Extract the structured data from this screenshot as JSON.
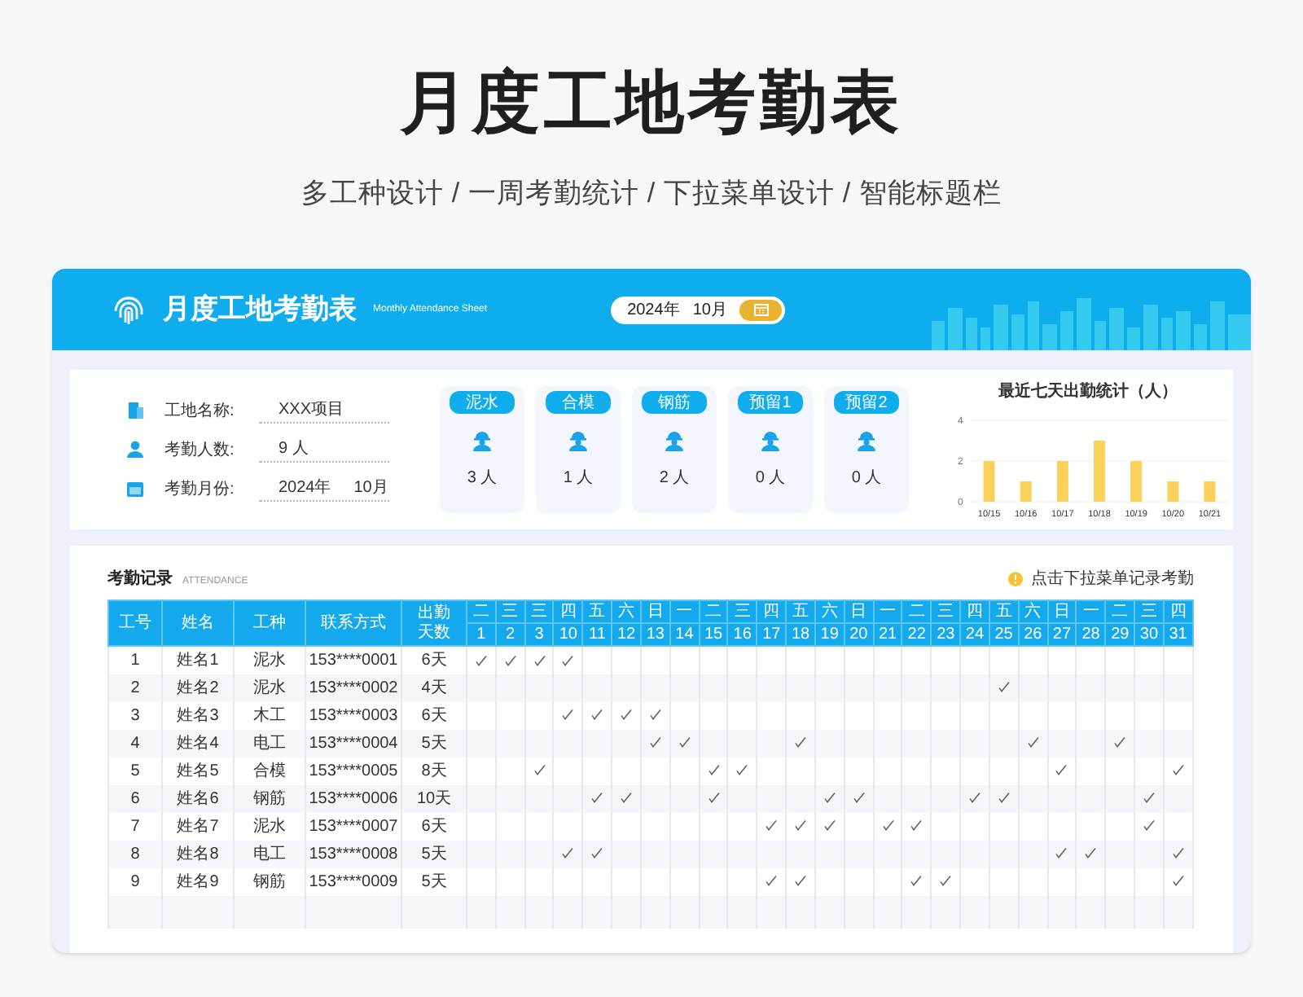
{
  "page_title": "月度工地考勤表",
  "page_subtitle": "多工种设计 / 一周考勤统计 / 下拉菜单设计 / 智能标题栏",
  "header": {
    "title": "月度工地考勤表",
    "subtitle": "Monthly Attendance Sheet",
    "year": "2024年",
    "month": "10月"
  },
  "site_info": [
    {
      "kind": "site",
      "label": "工地名称:",
      "values": [
        "XXX项目"
      ]
    },
    {
      "kind": "headcount",
      "label": "考勤人数:",
      "values": [
        "9 人"
      ]
    },
    {
      "kind": "month",
      "label": "考勤月份:",
      "values": [
        "2024年",
        "10月"
      ]
    }
  ],
  "trades": [
    {
      "name": "泥水",
      "count": "3 人"
    },
    {
      "name": "合模",
      "count": "1 人"
    },
    {
      "name": "钢筋",
      "count": "2 人"
    },
    {
      "name": "预留1",
      "count": "0 人"
    },
    {
      "name": "预留2",
      "count": "0 人"
    }
  ],
  "chart": {
    "title": "最近七天出勤统计（人）",
    "chart_data": {
      "type": "bar",
      "categories": [
        "10/15",
        "10/16",
        "10/17",
        "10/18",
        "10/19",
        "10/20",
        "10/21"
      ],
      "series": [
        {
          "color": "#fbd15b",
          "values": [
            2,
            1,
            2,
            3,
            2,
            1,
            1
          ]
        }
      ],
      "ylim": [
        0,
        4
      ],
      "yticks": [
        {
          "value": 0,
          "label": "0"
        },
        {
          "value": 2,
          "label": "2"
        },
        {
          "value": 4,
          "label": "4"
        }
      ]
    }
  },
  "attendance": {
    "title": "考勤记录",
    "subtitle": "ATTENDANCE",
    "hint": "点击下拉菜单记录考勤",
    "columns": [
      "工号",
      "姓名",
      "工种",
      "联系方式",
      "出勤天数"
    ],
    "days": [
      {
        "weekday": "二",
        "day": "1"
      },
      {
        "weekday": "三",
        "day": "2"
      },
      {
        "weekday": "三",
        "day": "3"
      },
      {
        "weekday": "四",
        "day": "10"
      },
      {
        "weekday": "五",
        "day": "11"
      },
      {
        "weekday": "六",
        "day": "12"
      },
      {
        "weekday": "日",
        "day": "13"
      },
      {
        "weekday": "一",
        "day": "14"
      },
      {
        "weekday": "二",
        "day": "15"
      },
      {
        "weekday": "三",
        "day": "16"
      },
      {
        "weekday": "四",
        "day": "17"
      },
      {
        "weekday": "五",
        "day": "18"
      },
      {
        "weekday": "六",
        "day": "19"
      },
      {
        "weekday": "日",
        "day": "20"
      },
      {
        "weekday": "一",
        "day": "21"
      },
      {
        "weekday": "二",
        "day": "22"
      },
      {
        "weekday": "三",
        "day": "23"
      },
      {
        "weekday": "四",
        "day": "24"
      },
      {
        "weekday": "五",
        "day": "25"
      },
      {
        "weekday": "六",
        "day": "26"
      },
      {
        "weekday": "日",
        "day": "27"
      },
      {
        "weekday": "一",
        "day": "28"
      },
      {
        "weekday": "二",
        "day": "29"
      },
      {
        "weekday": "三",
        "day": "30"
      },
      {
        "weekday": "四",
        "day": "31"
      }
    ],
    "rows": [
      {
        "id": "1",
        "name": "姓名1",
        "trade": "泥水",
        "phone": "153****0001",
        "days_present": "6天",
        "present": [
          true,
          true,
          true,
          true,
          false,
          false,
          false,
          false,
          false,
          false,
          false,
          false,
          false,
          false,
          false,
          false,
          false,
          false,
          false,
          false,
          false,
          false,
          false,
          false,
          false
        ]
      },
      {
        "id": "2",
        "name": "姓名2",
        "trade": "泥水",
        "phone": "153****0002",
        "days_present": "4天",
        "present": [
          false,
          false,
          false,
          false,
          false,
          false,
          false,
          false,
          false,
          false,
          false,
          false,
          false,
          false,
          false,
          false,
          false,
          false,
          true,
          false,
          false,
          false,
          false,
          false,
          false
        ]
      },
      {
        "id": "3",
        "name": "姓名3",
        "trade": "木工",
        "phone": "153****0003",
        "days_present": "6天",
        "present": [
          false,
          false,
          false,
          true,
          true,
          true,
          true,
          false,
          false,
          false,
          false,
          false,
          false,
          false,
          false,
          false,
          false,
          false,
          false,
          false,
          false,
          false,
          false,
          false,
          false
        ]
      },
      {
        "id": "4",
        "name": "姓名4",
        "trade": "电工",
        "phone": "153****0004",
        "days_present": "5天",
        "present": [
          false,
          false,
          false,
          false,
          false,
          false,
          true,
          true,
          false,
          false,
          false,
          true,
          false,
          false,
          false,
          false,
          false,
          false,
          false,
          true,
          false,
          false,
          true,
          false,
          false
        ]
      },
      {
        "id": "5",
        "name": "姓名5",
        "trade": "合模",
        "phone": "153****0005",
        "days_present": "8天",
        "present": [
          false,
          false,
          true,
          false,
          false,
          false,
          false,
          false,
          true,
          true,
          false,
          false,
          false,
          false,
          false,
          false,
          false,
          false,
          false,
          false,
          true,
          false,
          false,
          false,
          true
        ]
      },
      {
        "id": "6",
        "name": "姓名6",
        "trade": "钢筋",
        "phone": "153****0006",
        "days_present": "10天",
        "present": [
          false,
          false,
          false,
          false,
          true,
          true,
          false,
          false,
          true,
          false,
          false,
          false,
          true,
          true,
          false,
          false,
          false,
          true,
          true,
          false,
          false,
          false,
          false,
          true,
          false
        ]
      },
      {
        "id": "7",
        "name": "姓名7",
        "trade": "泥水",
        "phone": "153****0007",
        "days_present": "6天",
        "present": [
          false,
          false,
          false,
          false,
          false,
          false,
          false,
          false,
          false,
          false,
          true,
          true,
          true,
          false,
          true,
          true,
          false,
          false,
          false,
          false,
          false,
          false,
          false,
          true,
          false
        ]
      },
      {
        "id": "8",
        "name": "姓名8",
        "trade": "电工",
        "phone": "153****0008",
        "days_present": "5天",
        "present": [
          false,
          false,
          false,
          true,
          true,
          false,
          false,
          false,
          false,
          false,
          false,
          false,
          false,
          false,
          false,
          false,
          false,
          false,
          false,
          false,
          true,
          true,
          false,
          false,
          true
        ]
      },
      {
        "id": "9",
        "name": "姓名9",
        "trade": "钢筋",
        "phone": "153****0009",
        "days_present": "5天",
        "present": [
          false,
          false,
          false,
          false,
          false,
          false,
          false,
          false,
          false,
          false,
          true,
          true,
          false,
          false,
          false,
          true,
          true,
          false,
          false,
          false,
          false,
          false,
          false,
          false,
          true
        ]
      }
    ]
  }
}
